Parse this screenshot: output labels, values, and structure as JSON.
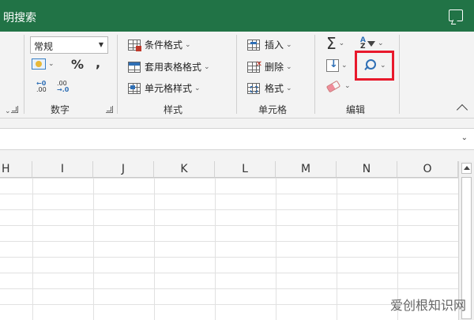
{
  "titlebar": {
    "title": "明搜索",
    "color": "#217346"
  },
  "number_group": {
    "format_value": "常规",
    "percent": "%",
    "comma": ",",
    "dec_increase_top": "←0",
    "dec_increase_bottom": ".00",
    "dec_decrease_top": ".00",
    "dec_decrease_bottom": "→.0",
    "label": "数字"
  },
  "styles_group": {
    "conditional_format": "条件格式",
    "format_as_table": "套用表格格式",
    "cell_styles": "单元格样式",
    "label": "样式"
  },
  "cells_group": {
    "insert": "插入",
    "delete": "删除",
    "format": "格式",
    "label": "单元格"
  },
  "editing_group": {
    "sigma": "Σ",
    "sort_top": "A",
    "sort_bottom": "Z",
    "label": "编辑"
  },
  "columns": [
    "H",
    "I",
    "J",
    "K",
    "L",
    "M",
    "N",
    "O"
  ],
  "watermark": "爱创根知识网",
  "highlight_color": "#e8192c"
}
